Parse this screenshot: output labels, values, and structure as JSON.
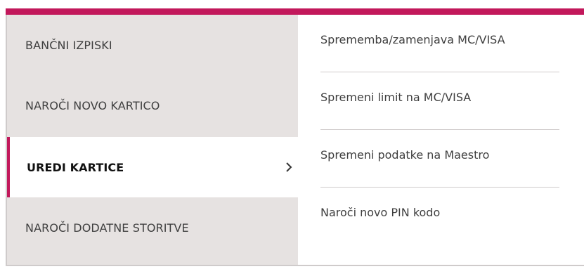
{
  "accent_color": "#c2185b",
  "left_menu": {
    "items": [
      {
        "label": "BANČNI IZPISKI",
        "active": false
      },
      {
        "label": "NAROČI NOVO KARTICO",
        "active": false
      },
      {
        "label": "UREDI KARTICE",
        "active": true,
        "icon": "chevron-right-icon"
      },
      {
        "label": "NAROČI DODATNE STORITVE",
        "active": false
      }
    ]
  },
  "submenu": {
    "items": [
      {
        "label": "Sprememba/zamenjava MC/VISA"
      },
      {
        "label": "Spremeni limit na MC/VISA"
      },
      {
        "label": "Spremeni podatke na Maestro"
      },
      {
        "label": "Naroči novo PIN kodo"
      }
    ]
  }
}
